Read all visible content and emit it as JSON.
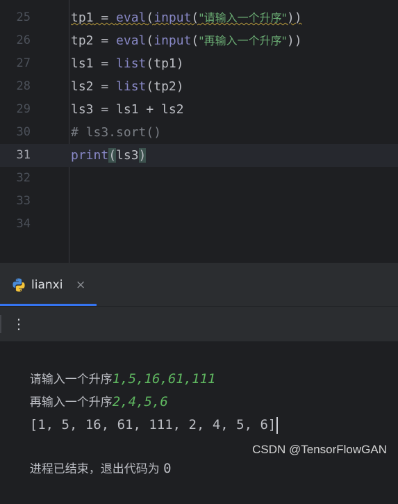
{
  "editor": {
    "lines": [
      {
        "num": "25",
        "var": "tp1",
        "op": " = ",
        "fn1": "eval",
        "p1": "(",
        "fn2": "input",
        "p2": "(",
        "str": "\"请输入一个升序\"",
        "p3": "))"
      },
      {
        "num": "26",
        "var": "tp2",
        "op": " = ",
        "fn1": "eval",
        "p1": "(",
        "fn2": "input",
        "p2": "(",
        "str": "\"再输入一个升序\"",
        "p3": "))"
      },
      {
        "num": "27",
        "pre": "ls1 = ",
        "fn": "list",
        "post": "(tp1)"
      },
      {
        "num": "28",
        "pre": "ls2 = ",
        "fn": "list",
        "post": "(tp2)"
      },
      {
        "num": "29",
        "text": "ls3 = ls1 + ls2"
      },
      {
        "num": "30",
        "comment": "# ls3.sort()"
      },
      {
        "num": "31",
        "fn": "print",
        "open": "(",
        "arg": "ls3",
        "close": ")"
      },
      {
        "num": "32"
      },
      {
        "num": "33"
      },
      {
        "num": "34"
      }
    ]
  },
  "run_panel": {
    "tab_label": "lianxi",
    "tab_close": "×",
    "icon": "python-icon",
    "accent": "#3574f0",
    "kebab": "⋮"
  },
  "console": {
    "line1_prompt": "请输入一个升序",
    "line1_input": "1,5,16,61,111",
    "line2_prompt": "再输入一个升序",
    "line2_input": "2,4,5,6",
    "line3_output": "[1, 5, 16, 61, 111, 2, 4, 5, 6]",
    "exit_text": "进程已结束，退出代码为 ",
    "exit_code": "0"
  },
  "watermark": "CSDN @TensorFlowGAN"
}
